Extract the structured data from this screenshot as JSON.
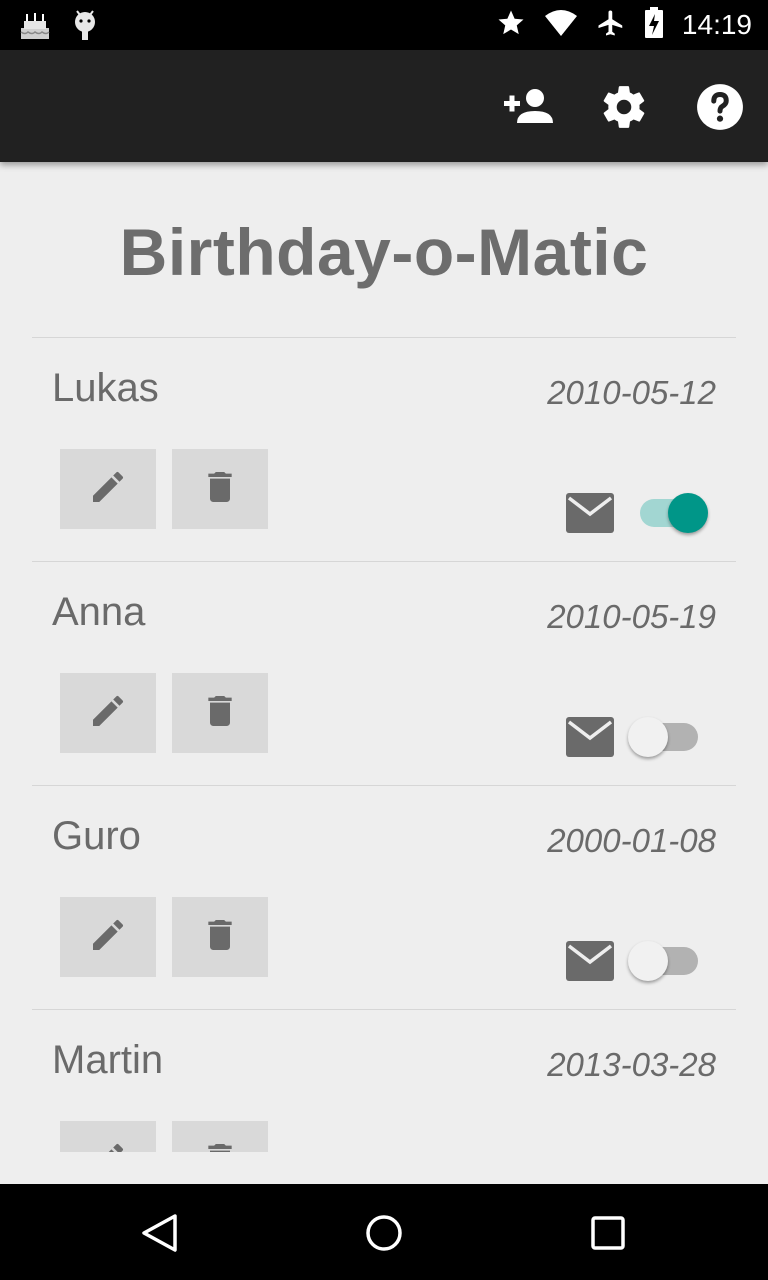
{
  "status_bar": {
    "time": "14:19",
    "left_icons": [
      "birthday-cake-icon",
      "android-icon"
    ],
    "right_icons": [
      "star-icon",
      "wifi-icon",
      "airplane-mode-icon",
      "battery-charging-icon"
    ]
  },
  "action_bar": {
    "actions": [
      "add-person-icon",
      "settings-gear-icon",
      "help-icon"
    ]
  },
  "app": {
    "title": "Birthday-o-Matic"
  },
  "entries": [
    {
      "name": "Lukas",
      "date": "2010-05-12",
      "email_enabled": true
    },
    {
      "name": "Anna",
      "date": "2010-05-19",
      "email_enabled": false
    },
    {
      "name": "Guro",
      "date": "2000-01-08",
      "email_enabled": false
    },
    {
      "name": "Martin",
      "date": "2013-03-28",
      "email_enabled": false
    }
  ],
  "colors": {
    "accent": "#009688",
    "action_bar": "#212121",
    "background": "#eeeeee"
  },
  "nav_bar": [
    "back-icon",
    "home-icon",
    "recents-icon"
  ]
}
